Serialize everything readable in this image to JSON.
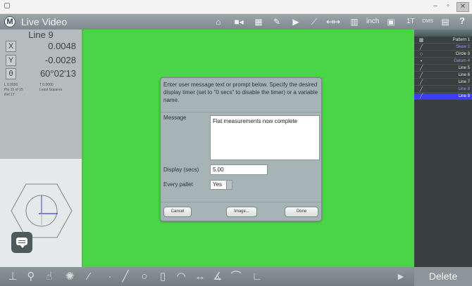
{
  "toolbar": {
    "logo": "M",
    "title": "Live Video",
    "units": "inch",
    "count": "1T",
    "help": "?"
  },
  "left_panel": {
    "feature_name": "Line 9",
    "coords": [
      {
        "axis": "X",
        "value": "0.0048"
      },
      {
        "axis": "Y",
        "value": "-0.0028"
      },
      {
        "axis": "θ",
        "value": "60°02'13"
      }
    ],
    "stats": [
      {
        "left": "L    0.0050",
        "right": "T    0.0000"
      },
      {
        "left": "Pts 15 of 15",
        "right": "Least Squares"
      },
      {
        "left": "Ref 1T",
        "right": ""
      }
    ]
  },
  "feature_list": {
    "items": [
      {
        "icon": "pattern-icon",
        "glyph": "▦",
        "label": "Pattern 1",
        "state": "normal"
      },
      {
        "icon": "line-icon",
        "glyph": "╱",
        "label": "Skew 2",
        "state": "dim"
      },
      {
        "icon": "circle-icon",
        "glyph": "○",
        "label": "Circle 3",
        "state": "normal"
      },
      {
        "icon": "point-icon",
        "glyph": "•",
        "label": "Datum 4",
        "state": "dim"
      },
      {
        "icon": "line-icon",
        "glyph": "╱",
        "label": "Line 5",
        "state": "normal"
      },
      {
        "icon": "line-icon",
        "glyph": "╱",
        "label": "Line 6",
        "state": "normal"
      },
      {
        "icon": "line-icon",
        "glyph": "╱",
        "label": "Line 7",
        "state": "normal"
      },
      {
        "icon": "line-icon",
        "glyph": "╱",
        "label": "Line 8",
        "state": "dim"
      },
      {
        "icon": "line-icon",
        "glyph": "╱",
        "label": "Line 9",
        "state": "selected"
      }
    ]
  },
  "dialog": {
    "prompt": "Enter user message text or prompt below. Specify the desired display timer (set to \"0 secs\" to disable the timer) or a variable name.",
    "message_label": "Message",
    "message_value": "Flat measurements now complete",
    "display_label": "Display (secs)",
    "display_value": "5.00",
    "pallet_label": "Every pallet",
    "pallet_value": "Yes",
    "cancel_label": "Cancel",
    "image_label": "Image...",
    "done_label": "Done"
  },
  "bottom": {
    "delete_label": "Delete"
  },
  "colors": {
    "video_bg": "#4ad548",
    "selected_row": "#3c3ff0",
    "panel_bg": "#b4bcbd"
  }
}
